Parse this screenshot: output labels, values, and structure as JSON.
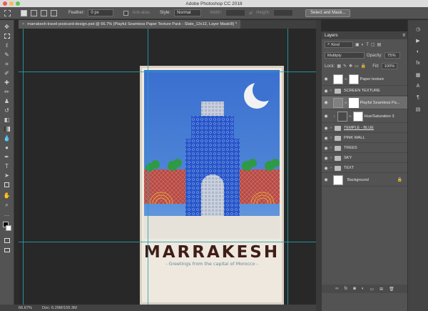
{
  "window": {
    "title": "Adobe Photoshop CC 2018"
  },
  "options_bar": {
    "feather_label": "Feather:",
    "feather_value": "0 px",
    "antialias_label": "Anti-alias",
    "style_label": "Style:",
    "style_value": "Normal",
    "width_label": "Width:",
    "height_label": "Height:",
    "select_mask_label": "Select and Mask..."
  },
  "document": {
    "tab_title": "marrakesh-travel-postcard-design.psd @ 66.7% (Playful Seamless Paper Texture Pack - Slate_12x12, Layer Mask/8) *",
    "poster_title": "MARRAKESH",
    "poster_subtitle": "- Greetings from the capital of Morocco -",
    "colors": {
      "sky_top": "#3a6fd0",
      "sky_bottom": "#5b93d9",
      "tower_blue": "#2755c8",
      "wall_red": "#b84b46",
      "tree_green": "#2f9a45",
      "title_brown": "#3f1e18",
      "guide_cyan": "#23a2b1"
    }
  },
  "status_bar": {
    "zoom": "66.67%",
    "doc": "Doc: 6.20M/155.3M"
  },
  "layers_panel": {
    "title": "Layers",
    "kind_filter": "Kind",
    "blend_mode": "Multiply",
    "opacity_label": "Opacity:",
    "opacity_value": "75%",
    "lock_label": "Lock:",
    "fill_label": "Fill:",
    "fill_value": "100%",
    "layers": [
      {
        "name": "Paper texture",
        "type": "mask-layer",
        "selected": false
      },
      {
        "name": "SCREEN TEXTURE",
        "type": "group",
        "selected": false
      },
      {
        "name": "Playful Seamless Pa...",
        "type": "mask-layer",
        "selected": true
      },
      {
        "name": "Hue/Saturation 3",
        "type": "adjustment",
        "selected": false
      },
      {
        "name": "TEMPLE - BLUE",
        "type": "group",
        "selected": false,
        "underline": true
      },
      {
        "name": "PINK WALL",
        "type": "group",
        "selected": false
      },
      {
        "name": "TREES",
        "type": "group",
        "selected": false
      },
      {
        "name": "SKY",
        "type": "group",
        "selected": false
      },
      {
        "name": "TEXT",
        "type": "group",
        "selected": false
      },
      {
        "name": "Background",
        "type": "background",
        "selected": false,
        "locked": true
      }
    ]
  },
  "icons": {
    "tools": [
      "move-icon",
      "marquee-icon",
      "lasso-icon",
      "quick-select-icon",
      "crop-icon",
      "eyedropper-icon",
      "healing-icon",
      "brush-icon",
      "stamp-icon",
      "history-brush-icon",
      "eraser-icon",
      "gradient-icon",
      "blur-icon",
      "dodge-icon",
      "pen-icon",
      "type-icon",
      "path-select-icon",
      "shape-icon",
      "hand-icon",
      "zoom-icon",
      "more-icon",
      "color-swatches",
      "quick-mask-icon",
      "screen-mode-icon"
    ],
    "right_dock": [
      "history-icon",
      "properties-icon",
      "adjustments-icon",
      "styles-icon",
      "swatches-icon",
      "character-icon",
      "paragraph-icon",
      "libraries-icon"
    ]
  }
}
